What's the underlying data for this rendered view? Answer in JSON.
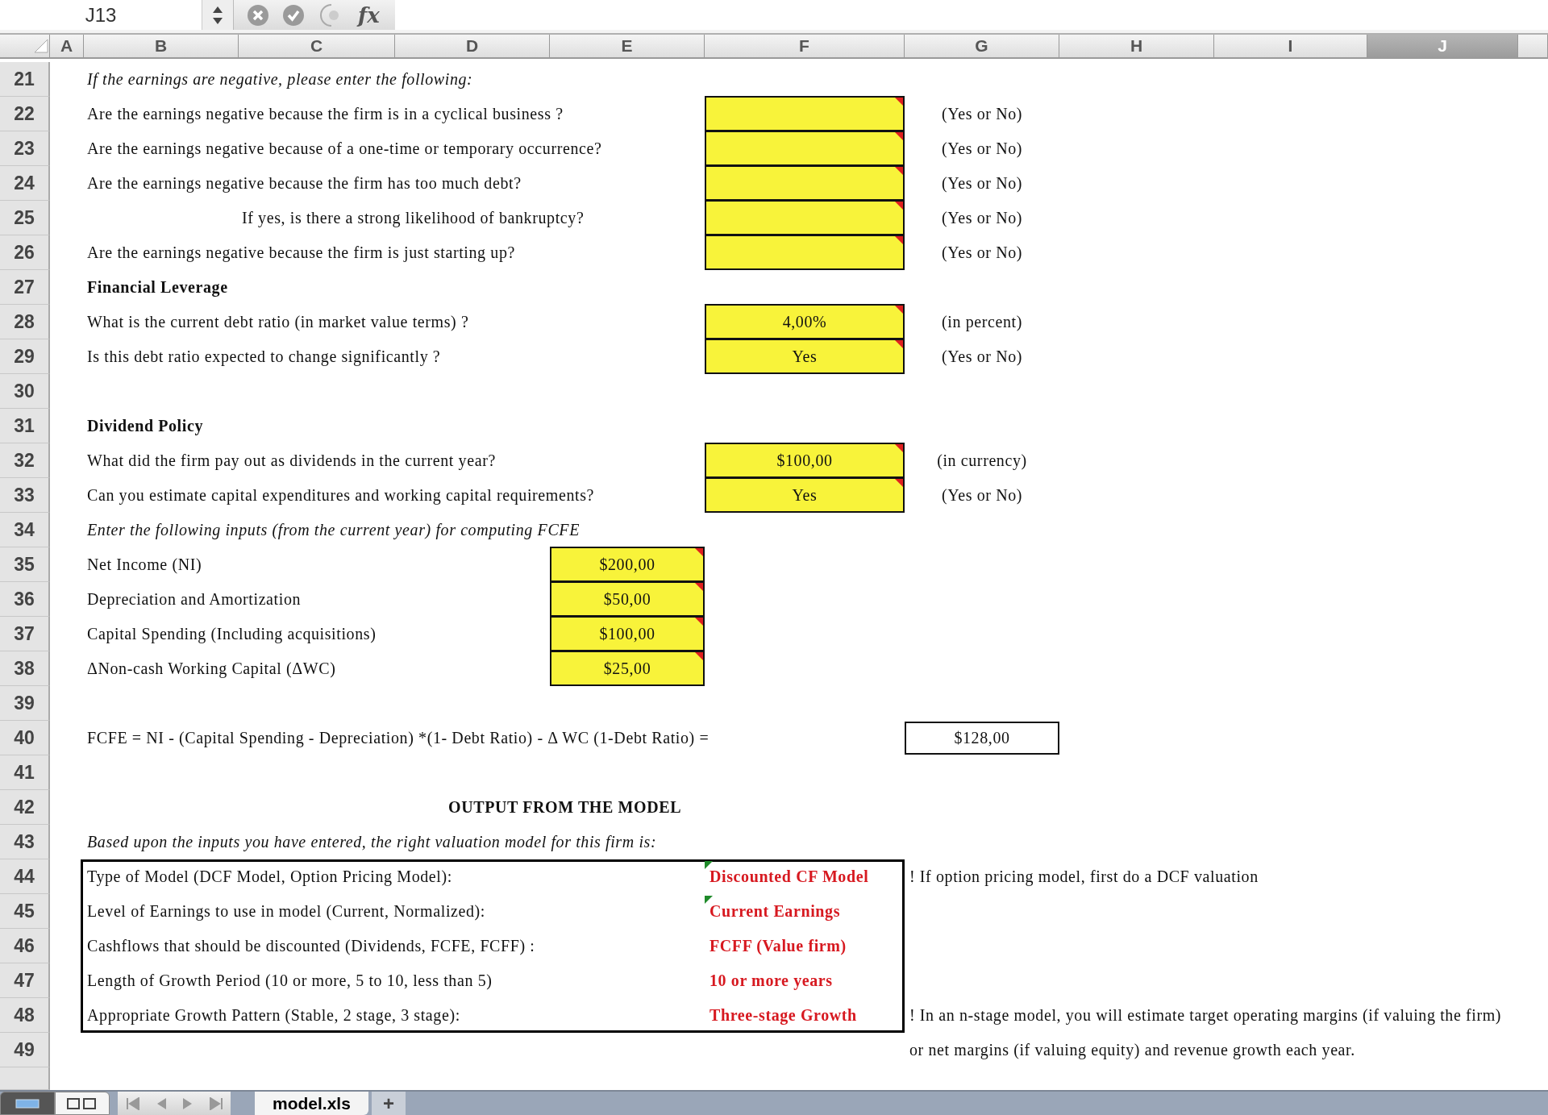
{
  "name_box": "J13",
  "fx_label": "fx",
  "columns": [
    {
      "label": "A",
      "selected": false
    },
    {
      "label": "B",
      "selected": false
    },
    {
      "label": "C",
      "selected": false
    },
    {
      "label": "D",
      "selected": false
    },
    {
      "label": "E",
      "selected": false
    },
    {
      "label": "F",
      "selected": false
    },
    {
      "label": "G",
      "selected": false
    },
    {
      "label": "H",
      "selected": false
    },
    {
      "label": "I",
      "selected": false
    },
    {
      "label": "J",
      "selected": true
    }
  ],
  "rows": [
    {
      "number": "21",
      "cells": {
        "B": {
          "kind": "italic",
          "text": "If the earnings are negative, please enter the following:"
        }
      }
    },
    {
      "number": "22",
      "cells": {
        "B": {
          "kind": "label",
          "text": "Are the earnings negative because the firm is in a cyclical business ?"
        },
        "F": {
          "kind": "input",
          "commented": true
        },
        "G": {
          "kind": "unit",
          "text": "(Yes or No)"
        }
      }
    },
    {
      "number": "23",
      "cells": {
        "B": {
          "kind": "label",
          "text": "Are the earnings negative because of a one-time or temporary occurrence?"
        },
        "F": {
          "kind": "input",
          "commented": true
        },
        "G": {
          "kind": "unit",
          "text": "(Yes or No)"
        }
      }
    },
    {
      "number": "24",
      "cells": {
        "B": {
          "kind": "label",
          "text": "Are the earnings negative because the firm has too much debt?"
        },
        "F": {
          "kind": "input",
          "commented": true
        },
        "G": {
          "kind": "unit",
          "text": "(Yes or No)"
        }
      }
    },
    {
      "number": "25",
      "cells": {
        "C": {
          "kind": "label",
          "text": "If yes, is there a strong likelihood of bankruptcy?"
        },
        "F": {
          "kind": "input",
          "commented": true
        },
        "G": {
          "kind": "unit",
          "text": "(Yes or No)"
        }
      }
    },
    {
      "number": "26",
      "cells": {
        "B": {
          "kind": "label",
          "text": "Are the earnings negative because the firm is just starting up?"
        },
        "F": {
          "kind": "input",
          "commented": true
        },
        "G": {
          "kind": "unit",
          "text": "(Yes or No)"
        }
      }
    },
    {
      "number": "27",
      "cells": {
        "B": {
          "kind": "heading",
          "text": "Financial Leverage"
        }
      }
    },
    {
      "number": "28",
      "cells": {
        "B": {
          "kind": "label",
          "text": "What is the current debt ratio (in market value terms) ?"
        },
        "F": {
          "kind": "input",
          "commented": true,
          "text": "4,00%"
        },
        "G": {
          "kind": "unit",
          "text": "(in percent)"
        }
      }
    },
    {
      "number": "29",
      "cells": {
        "B": {
          "kind": "label",
          "text": "Is this debt ratio expected to change significantly ?"
        },
        "F": {
          "kind": "input",
          "commented": true,
          "text": "Yes"
        },
        "G": {
          "kind": "unit",
          "text": "(Yes or No)"
        }
      }
    },
    {
      "number": "30",
      "cells": {}
    },
    {
      "number": "31",
      "cells": {
        "B": {
          "kind": "heading",
          "text": "Dividend Policy"
        }
      }
    },
    {
      "number": "32",
      "cells": {
        "B": {
          "kind": "label",
          "text": "What did the firm pay out as dividends in the current year?"
        },
        "F": {
          "kind": "input",
          "commented": true,
          "text": "$100,00"
        },
        "G": {
          "kind": "unit",
          "text": "(in currency)"
        }
      }
    },
    {
      "number": "33",
      "cells": {
        "B": {
          "kind": "label",
          "text": "Can you estimate capital expenditures and working capital requirements?"
        },
        "F": {
          "kind": "input",
          "commented": true,
          "text": "Yes"
        },
        "G": {
          "kind": "unit",
          "text": "(Yes or No)"
        }
      }
    },
    {
      "number": "34",
      "cells": {
        "B": {
          "kind": "italic",
          "text": "Enter the following inputs (from the current year) for computing FCFE"
        }
      }
    },
    {
      "number": "35",
      "cells": {
        "B": {
          "kind": "label",
          "text": "Net Income (NI)"
        },
        "E": {
          "kind": "input",
          "commented": true,
          "text": "$200,00"
        }
      }
    },
    {
      "number": "36",
      "cells": {
        "B": {
          "kind": "label",
          "text": "Depreciation and Amortization"
        },
        "E": {
          "kind": "input",
          "commented": true,
          "text": "$50,00"
        }
      }
    },
    {
      "number": "37",
      "cells": {
        "B": {
          "kind": "label",
          "text": "Capital Spending (Including acquisitions)"
        },
        "E": {
          "kind": "input",
          "commented": true,
          "text": "$100,00"
        }
      }
    },
    {
      "number": "38",
      "cells": {
        "B": {
          "kind": "label",
          "text": "ΔNon-cash Working Capital (ΔWC)"
        },
        "E": {
          "kind": "input",
          "commented": true,
          "text": "$25,00"
        }
      }
    },
    {
      "number": "39",
      "cells": {}
    },
    {
      "number": "40",
      "cells": {
        "B": {
          "kind": "label",
          "text": "FCFE = NI - (Capital Spending - Depreciation) *(1- Debt Ratio) - Δ WC (1-Debt Ratio) ="
        },
        "G": {
          "kind": "result",
          "text": "$128,00"
        }
      }
    },
    {
      "number": "41",
      "cells": {}
    },
    {
      "number": "42",
      "cells": {
        "D": {
          "kind": "title",
          "text": "OUTPUT FROM THE MODEL"
        }
      }
    },
    {
      "number": "43",
      "cells": {
        "B": {
          "kind": "italic",
          "text": "Based upon the inputs you have entered, the right valuation model for this firm is:"
        }
      }
    }
  ],
  "output_rows": [
    {
      "number": "44",
      "cells": {
        "B": {
          "kind": "label",
          "text": "Type of Model (DCF Model, Option Pricing Model):"
        },
        "F": {
          "kind": "output",
          "flagged": true,
          "text": "Discounted CF Model"
        },
        "G": {
          "kind": "note",
          "text": "! If option pricing model, first do a DCF valuation"
        }
      }
    },
    {
      "number": "45",
      "cells": {
        "B": {
          "kind": "label",
          "text": "Level of Earnings to use in model (Current, Normalized):"
        },
        "F": {
          "kind": "output",
          "flagged": true,
          "text": "Current Earnings"
        }
      }
    },
    {
      "number": "46",
      "cells": {
        "B": {
          "kind": "label",
          "text": "Cashflows that should be discounted (Dividends, FCFE, FCFF) :"
        },
        "F": {
          "kind": "output",
          "text": "FCFF (Value firm)"
        }
      }
    },
    {
      "number": "47",
      "cells": {
        "B": {
          "kind": "label",
          "text": "Length of Growth Period (10 or more, 5 to 10, less than 5)"
        },
        "F": {
          "kind": "output",
          "text": "10 or more years"
        }
      }
    },
    {
      "number": "48",
      "cells": {
        "B": {
          "kind": "label",
          "text": "Appropriate Growth Pattern (Stable, 2 stage,  3 stage):"
        },
        "F": {
          "kind": "output",
          "text": "Three-stage Growth"
        },
        "G": {
          "kind": "note",
          "text": "! In an n-stage model, you will estimate target operating margins (if valuing the firm)"
        }
      }
    }
  ],
  "after_rows": [
    {
      "number": "49",
      "cells": {
        "G": {
          "kind": "note",
          "text": "or net margins (if valuing equity) and revenue growth each year."
        }
      }
    }
  ],
  "sheet_tabs": [
    {
      "label": "model.xls",
      "selected": true
    }
  ],
  "add_sheet": "+"
}
